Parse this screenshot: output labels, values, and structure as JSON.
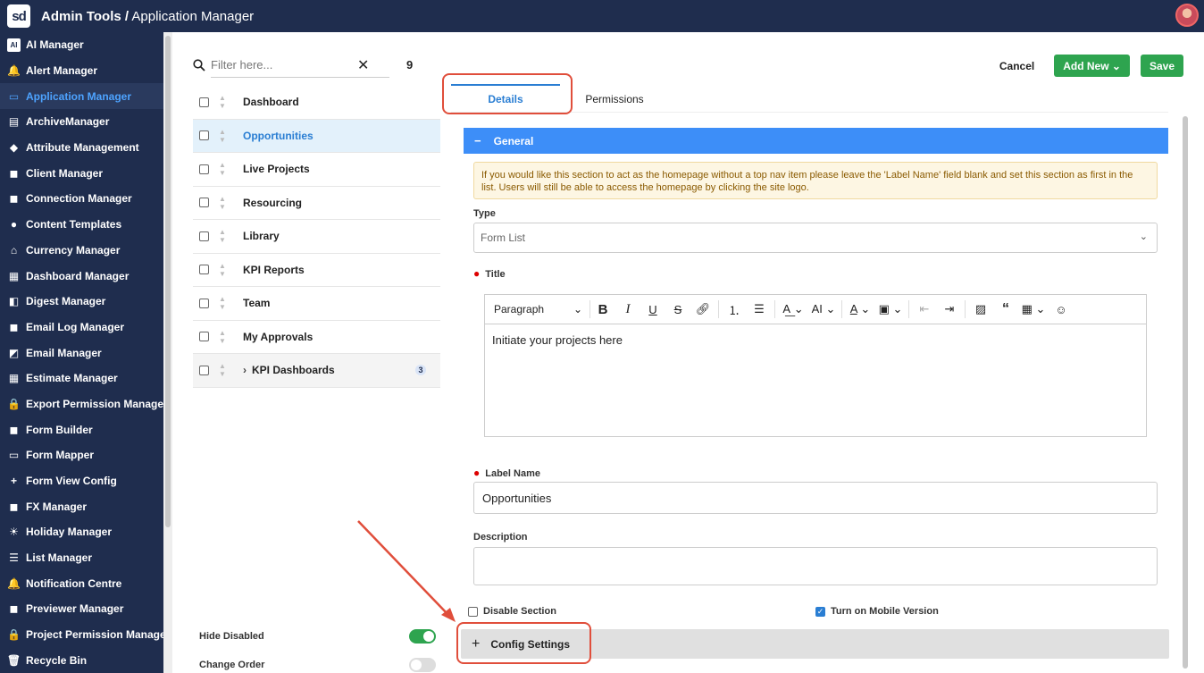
{
  "header": {
    "logo_text": "sd",
    "app": "Admin Tools /",
    "page": "Application Manager"
  },
  "sidebar": {
    "items": [
      {
        "label": "AI Manager",
        "icon": "ai-icon",
        "glyph": "AI"
      },
      {
        "label": "Alert Manager",
        "icon": "alert-icon",
        "glyph": "🔔"
      },
      {
        "label": "Application Manager",
        "icon": "laptop-icon",
        "glyph": "▭",
        "active": true
      },
      {
        "label": "ArchiveManager",
        "icon": "archive-icon",
        "glyph": "▤"
      },
      {
        "label": "Attribute Management",
        "icon": "tag-icon",
        "glyph": "◆"
      },
      {
        "label": "Client Manager",
        "icon": "briefcase-icon",
        "glyph": "◼"
      },
      {
        "label": "Connection Manager",
        "icon": "briefcase-icon",
        "glyph": "◼"
      },
      {
        "label": "Content Templates",
        "icon": "users-icon",
        "glyph": "●"
      },
      {
        "label": "Currency Manager",
        "icon": "bank-icon",
        "glyph": "⌂"
      },
      {
        "label": "Dashboard Manager",
        "icon": "dashboard-icon",
        "glyph": "▦"
      },
      {
        "label": "Digest Manager",
        "icon": "digest-icon",
        "glyph": "◧"
      },
      {
        "label": "Email Log Manager",
        "icon": "briefcase-icon",
        "glyph": "◼"
      },
      {
        "label": "Email Manager",
        "icon": "inbox-icon",
        "glyph": "◩"
      },
      {
        "label": "Estimate Manager",
        "icon": "calculator-icon",
        "glyph": "▦"
      },
      {
        "label": "Export Permission Manager",
        "icon": "lock-icon",
        "glyph": "🔒"
      },
      {
        "label": "Form Builder",
        "icon": "briefcase-icon",
        "glyph": "◼"
      },
      {
        "label": "Form Mapper",
        "icon": "laptop-icon",
        "glyph": "▭"
      },
      {
        "label": "Form View Config",
        "icon": "plus-icon",
        "glyph": "+"
      },
      {
        "label": "FX Manager",
        "icon": "briefcase-icon",
        "glyph": "◼"
      },
      {
        "label": "Holiday Manager",
        "icon": "sun-icon",
        "glyph": "☀"
      },
      {
        "label": "List Manager",
        "icon": "list-tree-icon",
        "glyph": "☰"
      },
      {
        "label": "Notification Centre",
        "icon": "bell-icon",
        "glyph": "🔔"
      },
      {
        "label": "Previewer Manager",
        "icon": "briefcase-icon",
        "glyph": "◼"
      },
      {
        "label": "Project Permission Manager",
        "icon": "lock-icon",
        "glyph": "🔒"
      },
      {
        "label": "Recycle Bin",
        "icon": "trash-icon",
        "glyph": "🗑"
      }
    ]
  },
  "list": {
    "filter_placeholder": "Filter here...",
    "count": "9",
    "items": [
      {
        "label": "Dashboard"
      },
      {
        "label": "Opportunities",
        "selected": true
      },
      {
        "label": "Live Projects"
      },
      {
        "label": "Resourcing"
      },
      {
        "label": "Library"
      },
      {
        "label": "KPI Reports"
      },
      {
        "label": "Team"
      },
      {
        "label": "My Approvals"
      },
      {
        "label": "KPI Dashboards",
        "group": true,
        "badge": "3"
      }
    ],
    "hide_disabled_label": "Hide Disabled",
    "hide_disabled_on": true,
    "change_order_label": "Change Order",
    "change_order_on": false
  },
  "actions": {
    "cancel": "Cancel",
    "add_new": "Add New",
    "save": "Save"
  },
  "tabs": {
    "details": "Details",
    "permissions": "Permissions"
  },
  "form": {
    "section_title": "General",
    "info_text": "If you would like this section to act as the homepage without a top nav item please leave the 'Label Name' field blank and set this section as first in the list. Users will still be able to access the homepage by clicking the site logo.",
    "type_label": "Type",
    "type_value": "Form List",
    "title_label": "Title",
    "editor_paragraph": "Paragraph",
    "editor_text": "Initiate your projects here",
    "label_name_label": "Label Name",
    "label_name_value": "Opportunities",
    "description_label": "Description",
    "description_value": "",
    "disable_section_label": "Disable Section",
    "disable_section_checked": false,
    "mobile_label": "Turn on Mobile Version",
    "mobile_checked": true,
    "config_settings": "Config Settings"
  },
  "colors": {
    "nav_bg": "#1f2d4e",
    "accent_blue": "#3d8ef8",
    "green": "#2ea44f",
    "annotation_red": "#e04e3b"
  }
}
